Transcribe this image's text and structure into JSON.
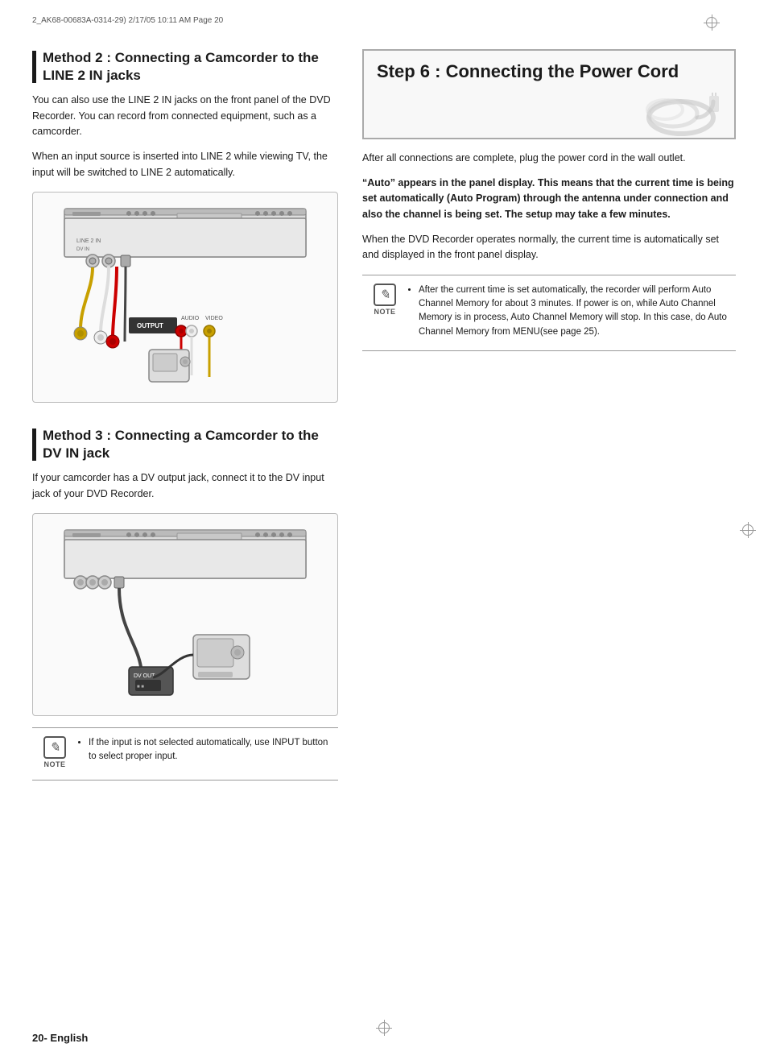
{
  "header": {
    "file_info": "2_AK68-00683A-0314-29)  2/17/05  10:11 AM  Page 20"
  },
  "left_column": {
    "method2": {
      "title": "Method 2 : Connecting a Camcorder to the LINE 2 IN jacks",
      "body1": "You can also use the LINE 2 IN jacks on the front panel of the DVD Recorder. You can record from connected equipment, such as a camcorder.",
      "body2": "When an input source is inserted into LINE 2 while viewing TV, the input will be switched to LINE 2 automatically."
    },
    "method3": {
      "title": "Method 3 : Connecting a Camcorder to the DV IN jack",
      "body1": "If your camcorder has a DV output jack, connect it to the DV input jack of your DVD Recorder.",
      "note_text": "If the input is not selected automatically, use INPUT button to select proper input."
    }
  },
  "right_column": {
    "step6": {
      "title": "Step 6 : Connecting the Power Cord",
      "body1": "After all connections are complete, plug the power cord in the wall outlet.",
      "body2_bold": "“Auto” appears in the panel display. This means that the current time is being set automatically (Auto Program) through the antenna under connection and also the channel is being set. The setup may take a few minutes.",
      "body3": "When the DVD Recorder operates  normally, the current time is automatically set and displayed in the front panel display.",
      "note_text": "After the current time is set automatically, the recorder will perform Auto Channel Memory for about 3 minutes. If power is on, while Auto Channel Memory is in process, Auto Channel Memory will stop. In this case, do Auto Channel Memory from MENU(see page 25)."
    }
  },
  "footer": {
    "page_number": "20",
    "language": "English"
  }
}
